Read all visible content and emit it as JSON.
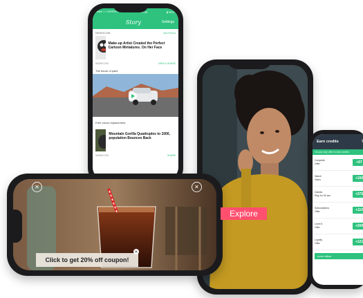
{
  "news_app": {
    "status_left": "●●●○○ CARRIER ᯤ",
    "status_center": "11:38",
    "status_right": "▮ 88%",
    "title": "Story",
    "settings_label": "Settings",
    "items": [
      {
        "source": "NEWSCOM",
        "source_right": "Ad Promo",
        "title": "Make-up Artist Created the Perfect Cartoon Miniatures. On Her Face",
        "meta_left": "NEWSCOM",
        "meta_right": "VIEW & SHARE"
      },
      {
        "section": "The future of paint"
      },
      {
        "section": "Free colour replacement"
      },
      {
        "title": "Mountain Gorilla Quadruples to 1000, population Bounces Back",
        "meta_left": "NEWSCOM",
        "meta_right": "SHARE"
      }
    ]
  },
  "portrait_app": {
    "explore_label": "Explore"
  },
  "credits_app": {
    "title": "Earn credits",
    "help": "?",
    "subheader": "Choose any offer to earn credits",
    "offers": [
      {
        "label": "Complete\nOffer",
        "amount": "+97"
      },
      {
        "label": "Watch\nVideo",
        "amount": "+150"
      },
      {
        "label": "Games\nPlay for 30 sec",
        "amount": "+375"
      },
      {
        "label": "Subscriptions\nOffer",
        "amount": "+110"
      },
      {
        "label": "Level 5\nOffer",
        "amount": "+209"
      },
      {
        "label": "Loyalty\nOffer",
        "amount": "+121"
      }
    ],
    "more_label": "more offers"
  },
  "ad_app": {
    "coupon_text": "Click to get 20% off coupon!",
    "close_symbol": "✕",
    "coupon_close_symbol": "✕"
  },
  "icons": [
    "settings-icon",
    "close-icon",
    "play-icon"
  ]
}
